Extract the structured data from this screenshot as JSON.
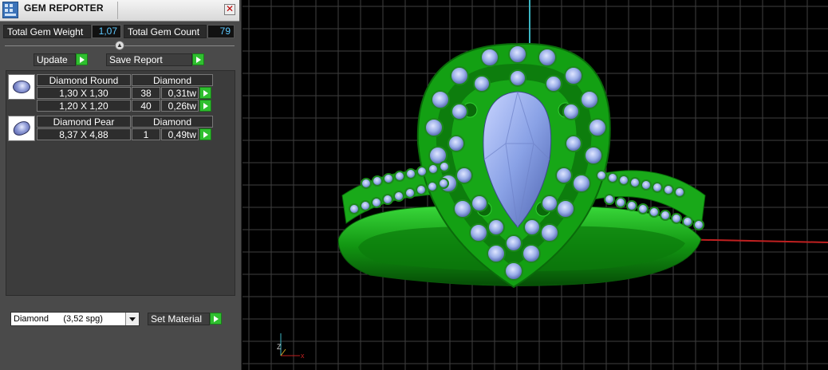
{
  "window": {
    "title": "GEM REPORTER",
    "close_glyph": "✕",
    "icon": "gem-reporter-app-icon"
  },
  "summary": {
    "total_weight_label": "Total Gem Weight",
    "total_weight_value": "1,07",
    "total_count_label": "Total Gem Count",
    "total_count_value": "79"
  },
  "toolbar": {
    "update_label": "Update",
    "save_report_label": "Save Report"
  },
  "gems": [
    {
      "type": "Diamond Round",
      "material": "Diamond",
      "thumb_icon": "round-gem-icon",
      "rows": [
        {
          "size": "1,30 X 1,30",
          "count": "38",
          "weight": "0,31tw"
        },
        {
          "size": "1,20 X 1,20",
          "count": "40",
          "weight": "0,26tw"
        }
      ]
    },
    {
      "type": "Diamond Pear",
      "material": "Diamond",
      "thumb_icon": "pear-gem-icon",
      "rows": [
        {
          "size": "8,37 X 4,88",
          "count": "1",
          "weight": "0,49tw"
        }
      ]
    }
  ],
  "material_select": {
    "value": "Diamond      (3,52 spg)"
  },
  "set_material_label": "Set Material",
  "colors": {
    "metal": "#1fb81f",
    "stone": "#9fb4f0",
    "grid": "#5a5a5a",
    "accent_value": "#5ec9ff",
    "play_button": "#2fbf2f"
  },
  "axes": {
    "z_label": "Z",
    "x_label": "x"
  }
}
